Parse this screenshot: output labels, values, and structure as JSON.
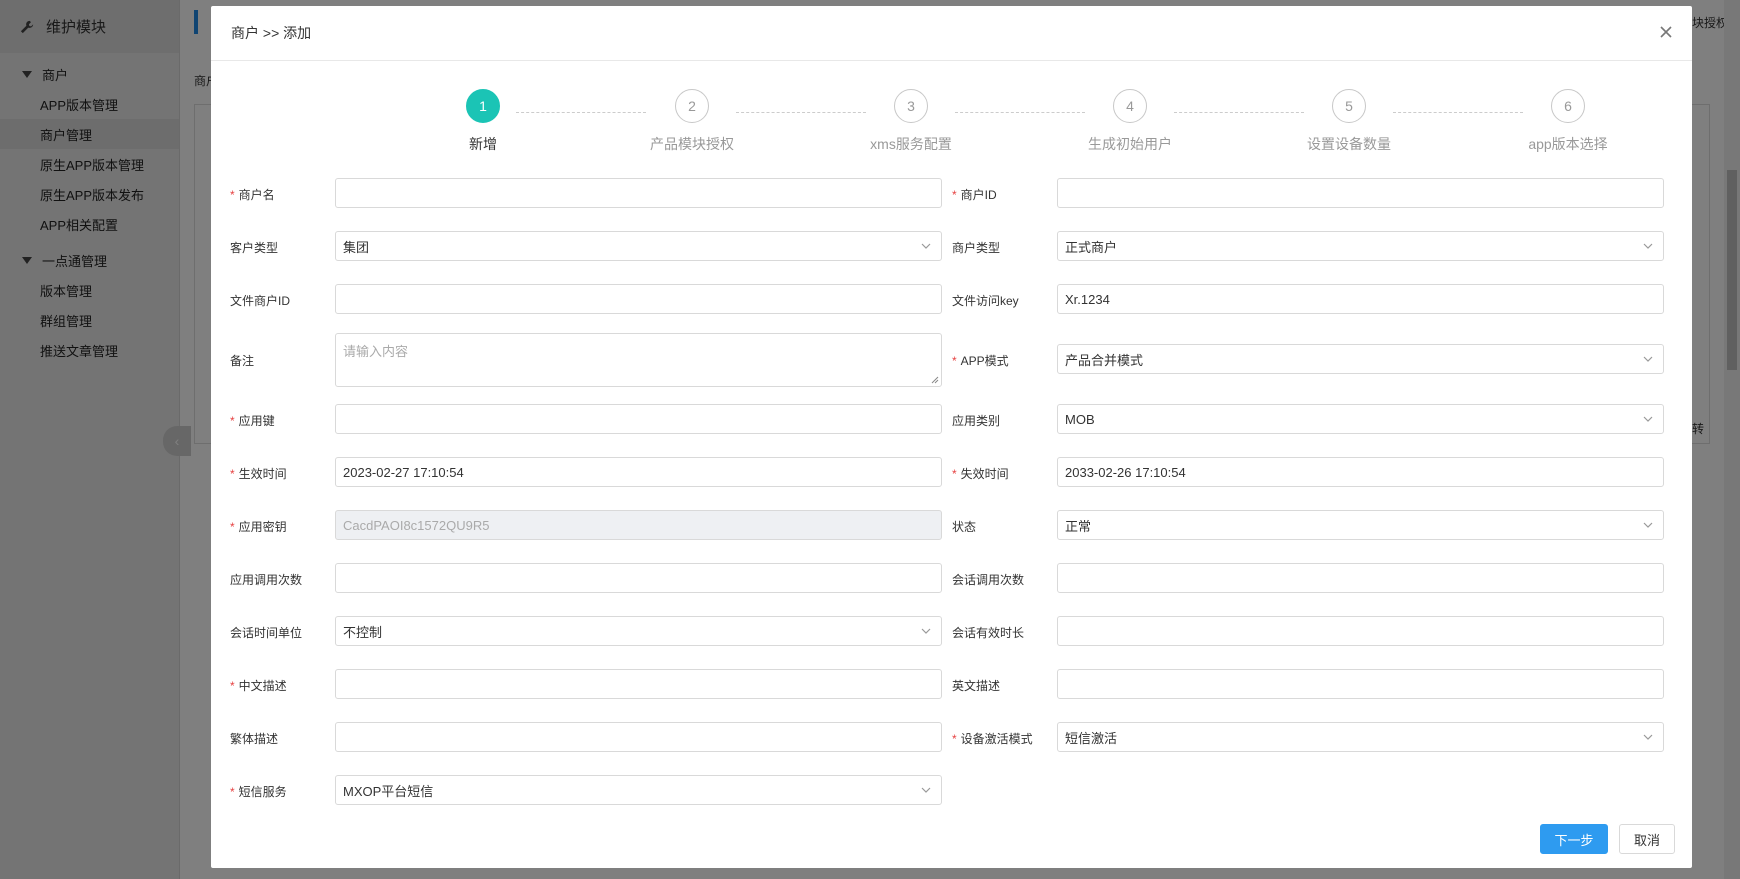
{
  "sidebar": {
    "title": "维护模块",
    "groups": [
      {
        "label": "商户",
        "items": [
          "APP版本管理",
          "商户管理",
          "原生APP版本管理",
          "原生APP版本发布",
          "APP相关配置"
        ]
      },
      {
        "label": "一点通管理",
        "items": [
          "版本管理",
          "群组管理",
          "推送文章管理"
        ]
      }
    ]
  },
  "background": {
    "tag_text": "商户",
    "right_text": "块授权",
    "right_text2": "转"
  },
  "modal": {
    "title": "商户 >> 添加",
    "steps": [
      {
        "num": "1",
        "label": "新增"
      },
      {
        "num": "2",
        "label": "产品模块授权"
      },
      {
        "num": "3",
        "label": "xms服务配置"
      },
      {
        "num": "4",
        "label": "生成初始用户"
      },
      {
        "num": "5",
        "label": "设置设备数量"
      },
      {
        "num": "6",
        "label": "app版本选择"
      }
    ],
    "form": {
      "merchant_name": {
        "label": "商户名",
        "value": ""
      },
      "merchant_id": {
        "label": "商户ID",
        "value": ""
      },
      "customer_type": {
        "label": "客户类型",
        "value": "集团"
      },
      "merchant_type": {
        "label": "商户类型",
        "value": "正式商户"
      },
      "file_merchant_id": {
        "label": "文件商户ID",
        "value": ""
      },
      "file_access_key": {
        "label": "文件访问key",
        "value": "Xr.1234"
      },
      "remark": {
        "label": "备注",
        "placeholder": "请输入内容"
      },
      "app_mode": {
        "label": "APP模式",
        "value": "产品合并模式"
      },
      "app_key": {
        "label": "应用键",
        "value": ""
      },
      "app_category": {
        "label": "应用类别",
        "value": "MOB"
      },
      "effective_time": {
        "label": "生效时间",
        "value": "2023-02-27 17:10:54"
      },
      "expire_time": {
        "label": "失效时间",
        "value": "2033-02-26 17:10:54"
      },
      "app_secret": {
        "label": "应用密钥",
        "value": "CacdPAOI8c1572QU9R5"
      },
      "status": {
        "label": "状态",
        "value": "正常"
      },
      "app_call_count": {
        "label": "应用调用次数",
        "value": ""
      },
      "session_call_count": {
        "label": "会话调用次数",
        "value": ""
      },
      "session_time_unit": {
        "label": "会话时间单位",
        "value": "不控制"
      },
      "session_valid_duration": {
        "label": "会话有效时长",
        "value": ""
      },
      "cn_desc": {
        "label": "中文描述",
        "value": ""
      },
      "en_desc": {
        "label": "英文描述",
        "value": ""
      },
      "tw_desc": {
        "label": "繁体描述",
        "value": ""
      },
      "device_activation_mode": {
        "label": "设备激活模式",
        "value": "短信激活"
      },
      "sms_service": {
        "label": "短信服务",
        "value": "MXOP平台短信"
      }
    },
    "buttons": {
      "next": "下一步",
      "cancel": "取消"
    }
  },
  "colors": {
    "accent": "#1bc4b5",
    "primary": "#2e9bf0",
    "required": "#e64242"
  }
}
